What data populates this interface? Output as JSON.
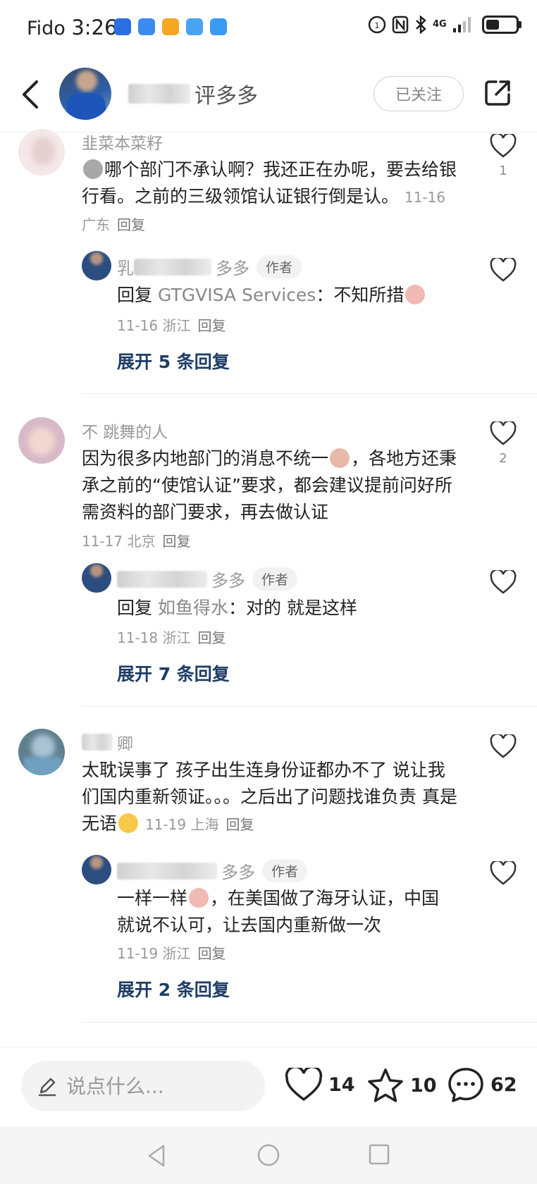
{
  "status_bar": {
    "carrier": "Fido",
    "time": "3:26",
    "network": "4G"
  },
  "header": {
    "username_visible": "评多多",
    "follow_label": "已关注"
  },
  "comments": [
    {
      "name": "韭菜本菜籽",
      "text": "哪个部门不承认啊？我还正在办呢，要去给银行看。之前的三级领馆认证银行倒是认。",
      "date": "11-16",
      "location": "广东",
      "reply_label": "回复",
      "likes": "1",
      "reply": {
        "name_visible": "多多",
        "badge": "作者",
        "prefix": "回复",
        "mention": "GTGVISA Services",
        "colon": "：",
        "text": "不知所措",
        "date": "11-16",
        "location": "浙江",
        "reply_label": "回复"
      },
      "expand": "展开 5 条回复"
    },
    {
      "name": "不   跳舞的人",
      "text_a": "因为很多内地部门的消息不统一",
      "text_b": "，各地方还秉承之前的“使馆认证”要求，都会建议提前问好所需资料的部门要求，再去做认证",
      "date": "11-17",
      "location": "北京",
      "reply_label": "回复",
      "likes": "2",
      "reply": {
        "name_visible": "多多",
        "badge": "作者",
        "prefix": "回复",
        "mention": "如鱼得水",
        "colon": "：",
        "text": "对的 就是这样",
        "date": "11-18",
        "location": "浙江",
        "reply_label": "回复"
      },
      "expand": "展开 7 条回复"
    },
    {
      "name": "卿",
      "text": "太耽误事了 孩子出生连身份证都办不了 说让我们国内重新领证。。。之后出了问题找谁负责 真是无语",
      "date": "11-19",
      "location": "上海",
      "reply_label": "回复",
      "reply": {
        "name_visible": "多多",
        "badge": "作者",
        "text_a": "一样一样",
        "text_b": "，在美国做了海牙认证，中国就说不认可，让去国内重新做一次",
        "date": "11-19",
        "location": "浙江",
        "reply_label": "回复"
      },
      "expand": "展开 2 条回复"
    }
  ],
  "bottom_bar": {
    "input_placeholder": "说点什么...",
    "likes": "14",
    "favorites": "10",
    "comments": "62"
  },
  "colors": {
    "expand_link": "#1f3d66",
    "meta": "#999999",
    "author_badge_bg": "#f2f2f2"
  }
}
